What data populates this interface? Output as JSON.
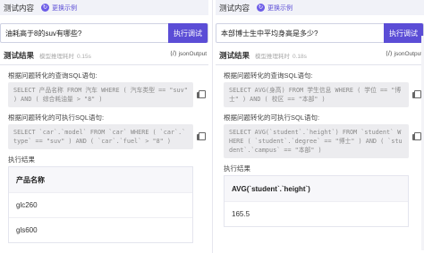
{
  "left": {
    "header": {
      "title": "测试内容",
      "swap_label": "更换示例"
    },
    "query": {
      "value": "油耗高于8的suv有哪些?",
      "run_label": "执行调试"
    },
    "results": {
      "title": "测试结果",
      "timing_label": "模型推理耗时",
      "timing_value": "0.15s",
      "json_label": "jsonOutput"
    },
    "sql_label": "根据问题转化的查询SQL语句:",
    "sql": "SELECT 产品名称 FROM 汽车 WHERE ( 汽车类型 == \"suv\" ) AND ( 综合耗油量 > \"8\" )",
    "exec_sql_label": "根据问题转化的可执行SQL语句:",
    "exec_sql": "SELECT `car`.`model` FROM `car` WHERE ( `car`.`type` == \"suv\" ) AND ( `car`.`fuel` > \"8\" )",
    "exec_result_label": "执行结果",
    "table": {
      "header": "产品名称",
      "rows": [
        "glc260",
        "gls600"
      ]
    }
  },
  "right": {
    "header": {
      "title": "测试内容",
      "swap_label": "更换示例"
    },
    "query": {
      "value": "本部博士生中平均身高是多少?",
      "run_label": "执行调试"
    },
    "results": {
      "title": "测试结果",
      "timing_label": "模型推理耗时",
      "timing_value": "0.18s",
      "json_label": "jsonOutput"
    },
    "sql_label": "根据问题转化的查询SQL语句:",
    "sql": "SELECT AVG(身高) FROM 学生信息 WHERE ( 学位 == \"博士\" ) AND ( 校区 == \"本部\" )",
    "exec_sql_label": "根据问题转化的可执行SQL语句:",
    "exec_sql": "SELECT AVG(`student`.`height`) FROM `student` WHERE ( `student`.`degree` == \"博士\" ) AND ( `student`.`campus` == \"本部\" )",
    "exec_result_label": "执行结果",
    "table": {
      "header": "AVG(`student`.`height`)",
      "rows": [
        "165.5"
      ]
    }
  },
  "colors": {
    "accent": "#5b4dd6",
    "header_bg": "#f1f2f8",
    "sql_bg": "#ececef"
  },
  "icons": {
    "swap": "refresh-icon",
    "json": "code-icon",
    "copy": "copy-icon"
  }
}
